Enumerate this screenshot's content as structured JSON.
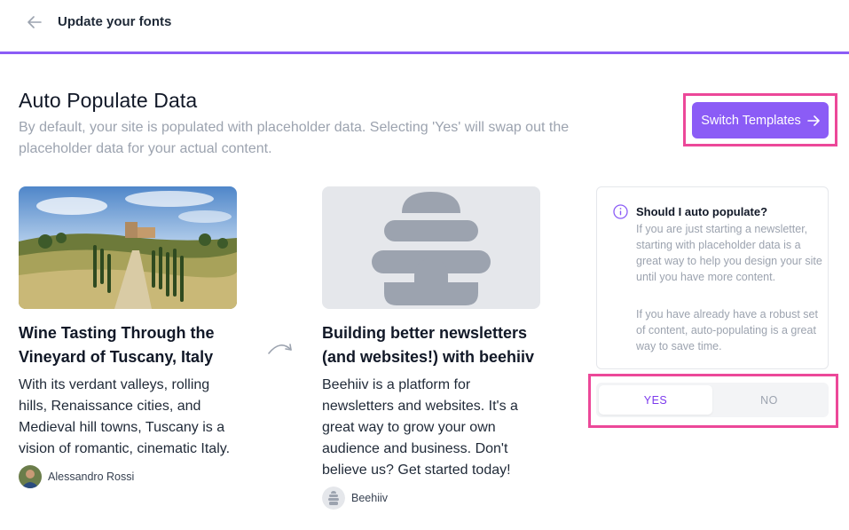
{
  "header": {
    "title": "Update your fonts",
    "back_icon": "arrow-left-icon",
    "accent_color": "#8b5cf6"
  },
  "main": {
    "heading": "Auto Populate Data",
    "description": "By default, your site is populated with placeholder data. Selecting 'Yes' will swap out the placeholder data for your actual content.",
    "switch_button_label": "Switch Templates",
    "switch_button_icon": "arrow-right-icon"
  },
  "cards": {
    "left": {
      "title": "Wine Tasting Through the Vineyard of Tuscany, Italy",
      "description": "With its verdant valleys, rolling hills, Renaissance cities, and Medieval hill towns, Tuscany is a vision of romantic, cinematic Italy.",
      "author": "Alessandro Rossi",
      "image_icon": "tuscany-landscape-image"
    },
    "swap_icon": "curved-arrow-icon",
    "right": {
      "title": "Building better newsletters (and websites!) with beehiiv",
      "description": "Beehiiv is a platform for newsletters and websites. It's a great way to grow your own audience and business. Don't believe us? Get started today!",
      "author": "Beehiiv",
      "image_icon": "beehive-logo"
    }
  },
  "info": {
    "icon": "info-icon",
    "title": "Should I auto populate?",
    "paragraph_1": "If you are just starting a newsletter, starting with placeholder data is a great way to help you design your site until you have more content.",
    "paragraph_2": "If you have already have a robust set of content, auto-populating is a great way to save time."
  },
  "toggle": {
    "yes_label": "YES",
    "no_label": "NO",
    "selected": "YES"
  },
  "colors": {
    "primary": "#8b5cf6",
    "highlight": "#ec4899",
    "muted_text": "#9ca3af"
  }
}
